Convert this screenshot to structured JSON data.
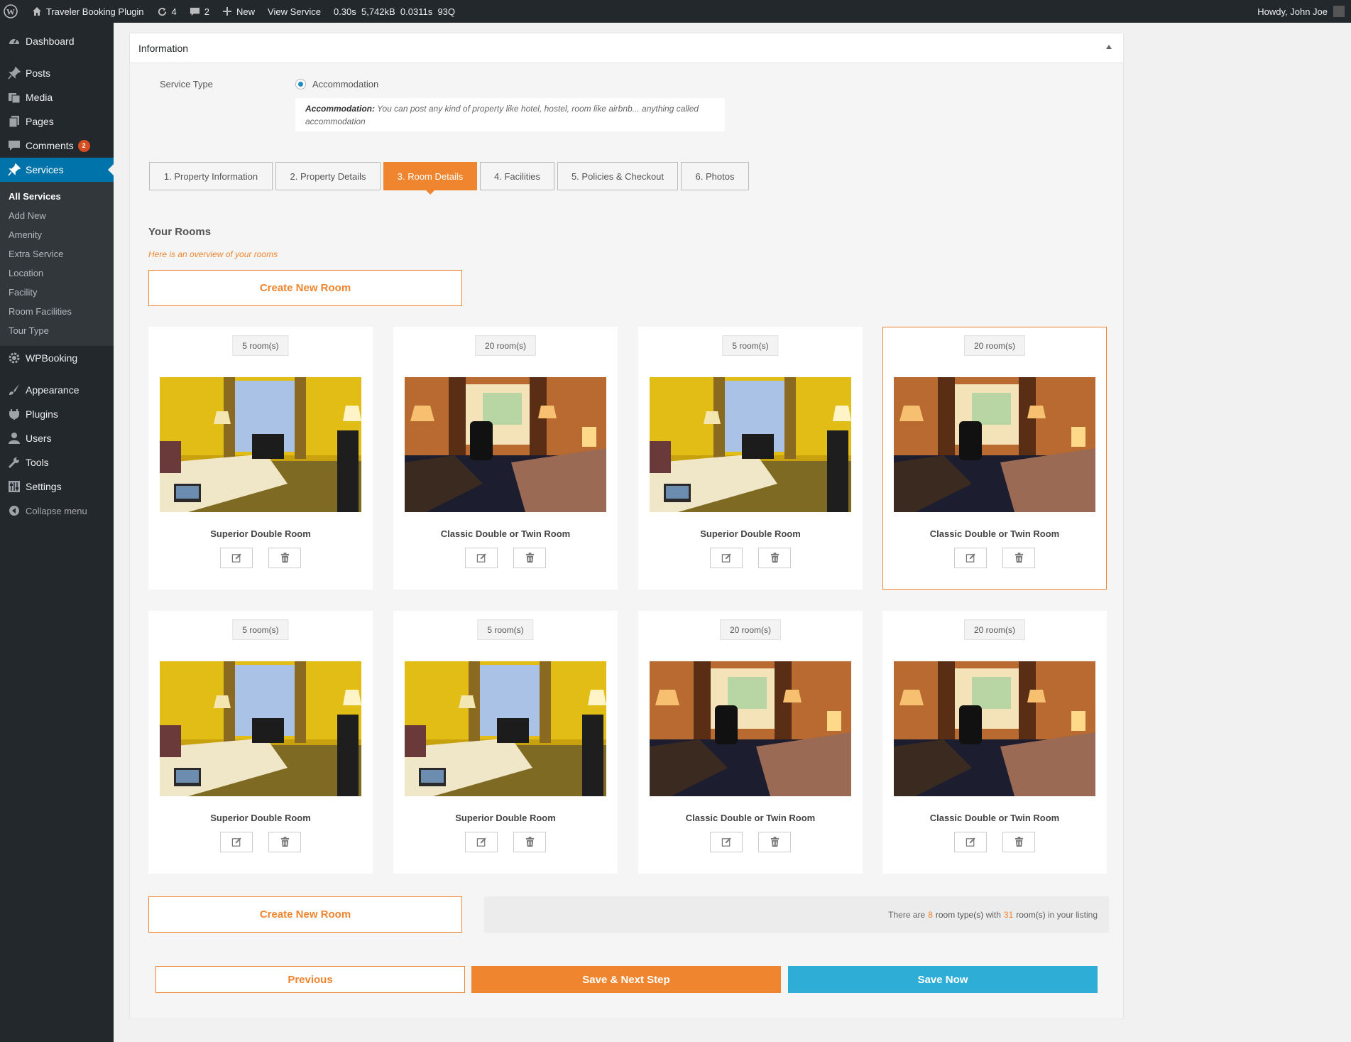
{
  "adminbar": {
    "site_name": "Traveler Booking Plugin",
    "updates_count": "4",
    "comments_count": "2",
    "new_label": "New",
    "view_label": "View Service",
    "time": "0.30s",
    "memory": "5,742kB",
    "query_time": "0.0311s",
    "queries": "93Q",
    "greeting": "Howdy, John Joe"
  },
  "sidebar": {
    "dashboard": "Dashboard",
    "posts": "Posts",
    "media": "Media",
    "pages": "Pages",
    "comments": "Comments",
    "comments_badge": "2",
    "services": "Services",
    "submenu": [
      "All Services",
      "Add New",
      "Amenity",
      "Extra Service",
      "Location",
      "Facility",
      "Room Facilities",
      "Tour Type"
    ],
    "wpbooking": "WPBooking",
    "appearance": "Appearance",
    "plugins": "Plugins",
    "users": "Users",
    "tools": "Tools",
    "settings": "Settings",
    "collapse": "Collapse menu"
  },
  "panel": {
    "title": "Information",
    "service_type_label": "Service Type",
    "service_type_value": "Accommodation",
    "type_desc_title": "Accommodation:",
    "type_desc_text": "You can post any kind of property like hotel, hostel, room like airbnb... anything called accommodation"
  },
  "tabs": [
    "1. Property Information",
    "2. Property Details",
    "3. Room Details",
    "4. Facilities",
    "5. Policies & Checkout",
    "6. Photos"
  ],
  "rooms": {
    "title": "Your Rooms",
    "subtitle": "Here is an overview of your rooms",
    "create_label": "Create New Room",
    "items": [
      {
        "count": "5 room(s)",
        "name": "Superior Double Room"
      },
      {
        "count": "20 room(s)",
        "name": "Classic Double or Twin Room"
      },
      {
        "count": "5 room(s)",
        "name": "Superior Double Room"
      },
      {
        "count": "20 room(s)",
        "name": "Classic Double or Twin Room"
      },
      {
        "count": "5 room(s)",
        "name": "Superior Double Room"
      },
      {
        "count": "5 room(s)",
        "name": "Superior Double Room"
      },
      {
        "count": "20 room(s)",
        "name": "Classic Double or Twin Room"
      },
      {
        "count": "20 room(s)",
        "name": "Classic Double or Twin Room"
      }
    ],
    "summary_pre": "There are",
    "summary_types": "8",
    "summary_kw1": "room type(s)",
    "summary_mid": "with",
    "summary_rooms": "31",
    "summary_kw2": "room(s)",
    "summary_post": "in your listing"
  },
  "footer": {
    "prev": "Previous",
    "next": "Save & Next Step",
    "save": "Save Now"
  },
  "colors": {
    "accent": "#f0852f",
    "save": "#2eaed6",
    "admin_dark": "#23282d",
    "wp_blue": "#0073aa"
  }
}
